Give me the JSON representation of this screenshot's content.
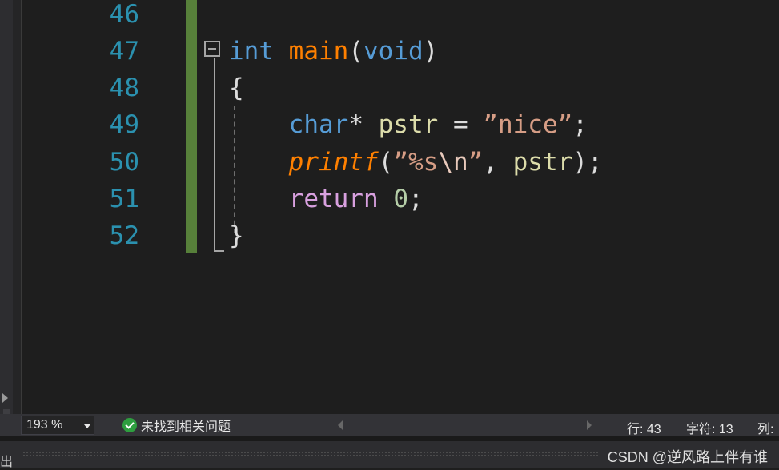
{
  "editor": {
    "line_numbers": [
      "46",
      "47",
      "48",
      "49",
      "50",
      "51",
      "52"
    ],
    "code": {
      "l47": {
        "kw": "int",
        "fn": "main",
        "open": "(",
        "param": "void",
        "close": ")"
      },
      "l48": {
        "brace": "{"
      },
      "l49": {
        "type": "char",
        "star": "* ",
        "var": "pstr",
        "eq": " = ",
        "str": "”nice”",
        "semi": ";"
      },
      "l50": {
        "fn": "printf",
        "open": "(",
        "str_a": "”%s",
        "esc": "\\n",
        "str_b": "”",
        "comma": ", ",
        "var": "pstr",
        "close": ");"
      },
      "l51": {
        "kw": "return",
        "sp": " ",
        "num": "0",
        "semi": ";"
      },
      "l52": {
        "brace": "}"
      }
    }
  },
  "statusbar": {
    "zoom": "193 %",
    "issues": "未找到相关问题",
    "line": "行: 43",
    "char": "字符: 13",
    "col": "列:"
  },
  "bottom": {
    "output_tab": "出",
    "watermark": "CSDN @逆风路上伴有谁"
  },
  "colors": {
    "keyword": "#569cd6",
    "function": "#ff8000",
    "variable": "#dcdcaa",
    "string": "#d69d85",
    "control": "#d8a0df",
    "number": "#b5cea8",
    "line_number": "#2b91af",
    "change_bar": "#57803a"
  }
}
